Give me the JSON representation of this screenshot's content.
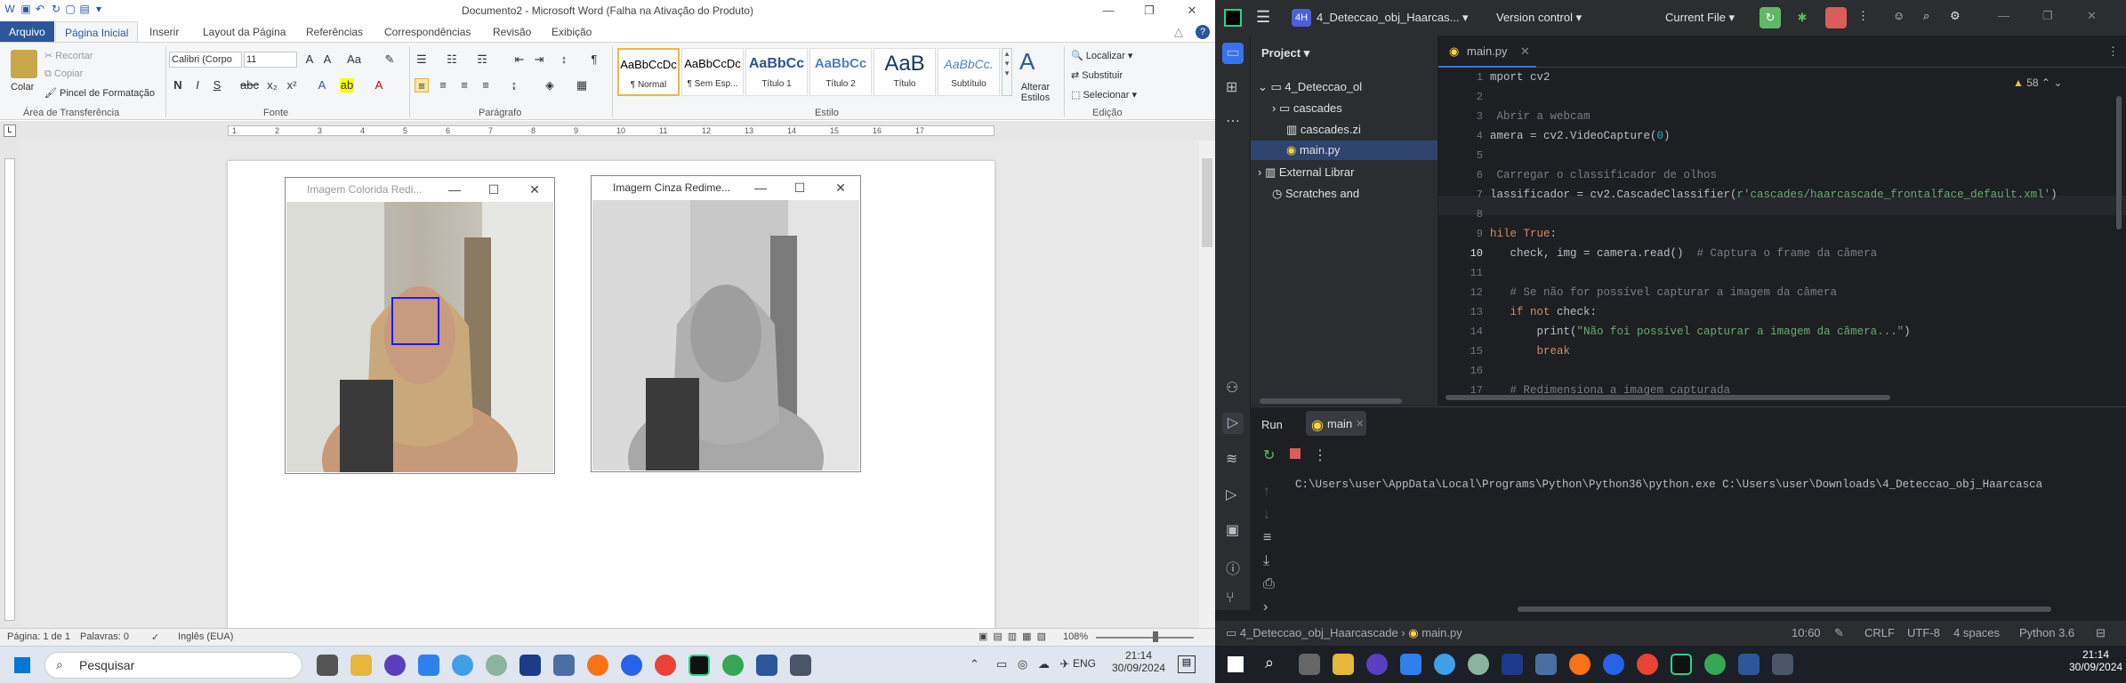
{
  "word": {
    "title": "Documento2 - Microsoft Word (Falha na Ativação do Produto)",
    "tabs": [
      "Arquivo",
      "Página Inicial",
      "Inserir",
      "Layout da Página",
      "Referências",
      "Correspondências",
      "Revisão",
      "Exibição"
    ],
    "clipboard": {
      "paste": "Colar",
      "cut": "Recortar",
      "copy": "Copiar",
      "format_painter": "Pincel de Formatação",
      "group": "Área de Transferência"
    },
    "font": {
      "name": "Calibri (Corpo",
      "size": "11",
      "group": "Fonte"
    },
    "paragraph_group": "Parágrafo",
    "styles": [
      {
        "sample": "AaBbCcDc",
        "name": "¶ Normal"
      },
      {
        "sample": "AaBbCcDc",
        "name": "¶ Sem Esp..."
      },
      {
        "sample": "AaBbCc",
        "name": "Título 1"
      },
      {
        "sample": "AaBbCc",
        "name": "Título 2"
      },
      {
        "sample": "AaB",
        "name": "Título"
      },
      {
        "sample": "AaBbCc.",
        "name": "Subtítulo"
      }
    ],
    "styles_group": "Estilo",
    "change_styles": "Alterar Estilos",
    "editing": {
      "find": "Localizar",
      "replace": "Substituir",
      "select": "Selecionar",
      "group": "Edição"
    },
    "ruler_numbers": [
      "1",
      "2",
      "3",
      "4",
      "5",
      "6",
      "7",
      "8",
      "9",
      "10",
      "11",
      "12",
      "13",
      "14",
      "15",
      "16",
      "17"
    ],
    "window1_title": "Imagem Colorida Redi...",
    "window2_title": "Imagem Cinza Redime...",
    "status": {
      "page": "Página: 1 de 1",
      "words": "Palavras: 0",
      "lang": "Inglês (EUA)",
      "zoom": "108%"
    }
  },
  "taskbar1": {
    "search": "Pesquisar",
    "lang": "ENG",
    "time": "21:14",
    "date": "30/09/2024"
  },
  "ide": {
    "project_badge": "4H",
    "project_name": "4_Deteccao_obj_Haarcas...",
    "vcs": "Version control",
    "run_config": "Current File",
    "panel": "Project",
    "tree": [
      {
        "label": "4_Deteccao_ol"
      },
      {
        "label": "cascades"
      },
      {
        "label": "cascades.zi"
      },
      {
        "label": "main.py"
      },
      {
        "label": "External Librar"
      },
      {
        "label": "Scratches and"
      }
    ],
    "tab": "main.py",
    "warnings": "58",
    "lines": [
      "1",
      "2",
      "3",
      "4",
      "5",
      "6",
      "7",
      "8",
      "9",
      "10",
      "11",
      "12",
      "13",
      "14",
      "15",
      "16",
      "17"
    ],
    "code": [
      [
        {
          "t": "mport cv2",
          "c": ""
        }
      ],
      [
        {
          "t": "",
          "c": ""
        }
      ],
      [
        {
          "t": " Abrir a webcam",
          "c": "cm"
        }
      ],
      [
        {
          "t": "amera = cv2.VideoCapture(",
          "c": ""
        },
        {
          "t": "0",
          "c": "num"
        },
        {
          "t": ")",
          "c": ""
        }
      ],
      [
        {
          "t": "",
          "c": ""
        }
      ],
      [
        {
          "t": " Carregar o classificador de olhos",
          "c": "cm"
        }
      ],
      [
        {
          "t": "lassificador = cv2.CascadeClassifier(",
          "c": ""
        },
        {
          "t": "r'cascades/haarcascade_frontalface_default.xml'",
          "c": "str"
        },
        {
          "t": ")",
          "c": ""
        }
      ],
      [
        {
          "t": "",
          "c": ""
        }
      ],
      [
        {
          "t": "hile ",
          "c": "kw"
        },
        {
          "t": "True",
          "c": "kw"
        },
        {
          "t": ":",
          "c": ""
        }
      ],
      [
        {
          "t": "   check, img = camera.read()  ",
          "c": ""
        },
        {
          "t": "# Captura o frame da câmera",
          "c": "cm"
        }
      ],
      [
        {
          "t": "",
          "c": ""
        }
      ],
      [
        {
          "t": "   # Se não for possível capturar a imagem da câmera",
          "c": "cm"
        }
      ],
      [
        {
          "t": "   ",
          "c": ""
        },
        {
          "t": "if not",
          "c": "kw"
        },
        {
          "t": " check:",
          "c": ""
        }
      ],
      [
        {
          "t": "       print(",
          "c": ""
        },
        {
          "t": "\"Não foi possível capturar a imagem da câmera...\"",
          "c": "str"
        },
        {
          "t": ")",
          "c": ""
        }
      ],
      [
        {
          "t": "       ",
          "c": ""
        },
        {
          "t": "break",
          "c": "kw"
        }
      ],
      [
        {
          "t": "",
          "c": ""
        }
      ],
      [
        {
          "t": "   # Redimensiona a imagem capturada",
          "c": "cm"
        }
      ]
    ],
    "run_label": "Run",
    "run_tab": "main",
    "console": "C:\\Users\\user\\AppData\\Local\\Programs\\Python\\Python36\\python.exe C:\\Users\\user\\Downloads\\4_Deteccao_obj_Haarcasca",
    "breadcrumb": [
      "4_Deteccao_obj_Haarcascade",
      "main.py"
    ],
    "status": {
      "pos": "10:60",
      "eol": "CRLF",
      "enc": "UTF-8",
      "indent": "4 spaces",
      "py": "Python 3.6"
    }
  },
  "taskbar2": {
    "time": "21:14",
    "date": "30/09/2024"
  },
  "colors": {
    "word_blue": "#2b579a",
    "face_box": "#1a1aff",
    "ide_bg": "#1e1f22",
    "run_green": "#5fb865",
    "stop_red": "#db5c5c"
  }
}
